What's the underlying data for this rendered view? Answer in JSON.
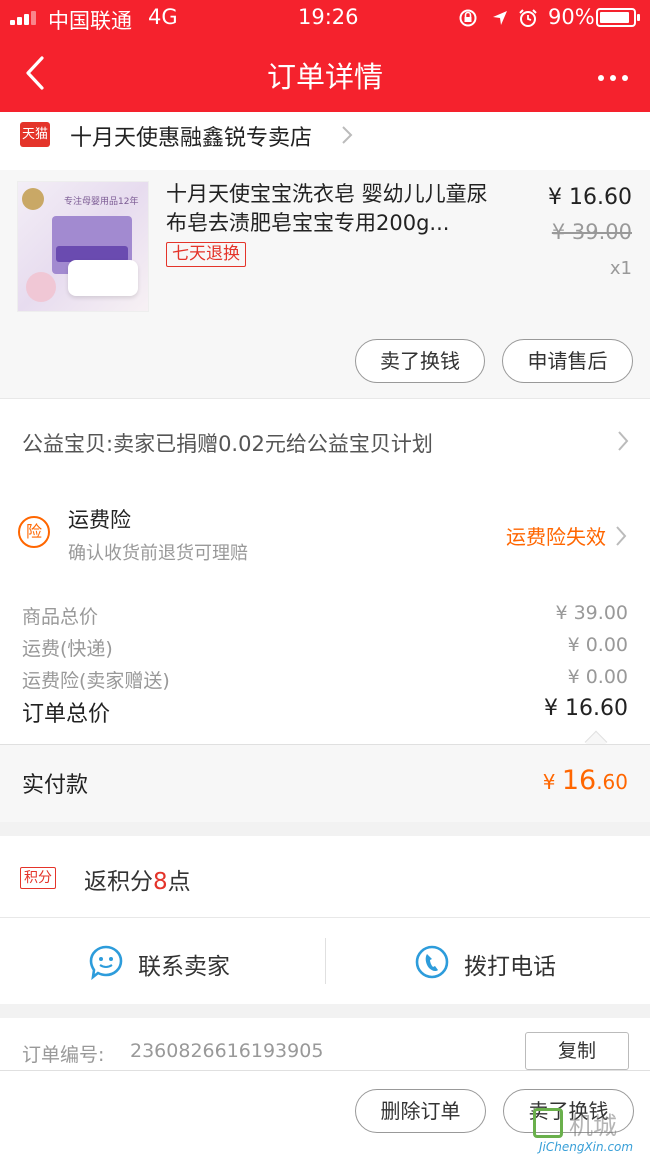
{
  "status_bar": {
    "carrier": "中国联通",
    "network": "4G",
    "time": "19:26",
    "battery_percent": "90%",
    "battery_level": 0.9,
    "icons": [
      "signal-icon",
      "orientation-lock-icon",
      "location-icon",
      "alarm-icon",
      "battery-icon"
    ]
  },
  "nav": {
    "title": "订单详情",
    "back_icon": "chevron-left-icon",
    "more_icon": "more-dots-icon"
  },
  "store": {
    "badge": "天猫",
    "name": "十月天使惠融鑫锐专卖店"
  },
  "product": {
    "title": "十月天使宝宝洗衣皂 婴幼儿儿童尿布皂去渍肥皂宝宝专用200g...",
    "return_tag": "七天退换",
    "price": "¥ 16.60",
    "original_price": "¥ 39.00",
    "quantity": "x1",
    "buttons": {
      "sell": "卖了换钱",
      "after_sale": "申请售后"
    }
  },
  "charity": {
    "text": "公益宝贝:卖家已捐赠0.02元给公益宝贝计划"
  },
  "insurance": {
    "icon_text": "险",
    "title": "运费险",
    "subtitle": "确认收货前退货可理赔",
    "status": "运费险失效"
  },
  "summary": {
    "rows": [
      {
        "label": "商品总价",
        "value": "¥ 39.00"
      },
      {
        "label": "运费(快递)",
        "value": "¥ 0.00"
      },
      {
        "label": "运费险(卖家赠送)",
        "value": "¥ 0.00"
      }
    ],
    "total_label": "订单总价",
    "total_value": "¥ 16.60"
  },
  "payment": {
    "label": "实付款",
    "currency": "¥",
    "integer": "16",
    "decimal": ".60"
  },
  "points": {
    "badge": "积分",
    "prefix": "返积分",
    "count": "8",
    "suffix": "点"
  },
  "contact": {
    "seller": "联系卖家",
    "phone": "拨打电话"
  },
  "order": {
    "number_label": "订单编号:",
    "number": "2360826616193905",
    "copy": "复制"
  },
  "bottom_bar": {
    "delete": "删除订单",
    "sell": "卖了换钱"
  },
  "watermark": {
    "text": "机城",
    "url": "JiChengXin.com"
  },
  "colors": {
    "brand_red": "#f5222d",
    "orange_accent": "#ff6600",
    "tag_red": "#e4342a",
    "chat_blue": "#2d9cdb"
  }
}
